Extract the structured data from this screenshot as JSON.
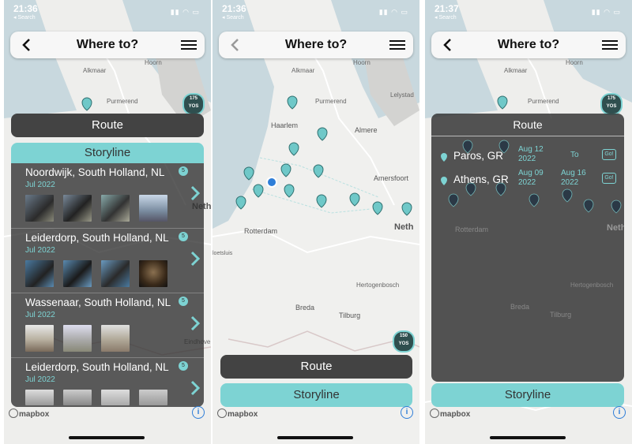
{
  "screens": [
    {
      "status": {
        "time": "21:36",
        "back": "◂ Search"
      },
      "header": {
        "title": "Where to?"
      },
      "route_label": "Route",
      "storyline_label": "Storyline",
      "cluster": {
        "count": "175",
        "label": "YOS"
      },
      "entries": [
        {
          "place": "Noordwijk, South Holland, NL",
          "date": "Jul 2022",
          "count": "5"
        },
        {
          "place": "Leiderdorp, South Holland, NL",
          "date": "Jul 2022",
          "count": "5"
        },
        {
          "place": "Wassenaar, South Holland, NL",
          "date": "Jul 2022",
          "count": "5"
        },
        {
          "place": "Leiderdorp, South Holland, NL",
          "date": "Jul 2022",
          "count": "5"
        }
      ],
      "mapbox": "mapbox",
      "info": "i"
    },
    {
      "status": {
        "time": "21:36",
        "back": "◂ Search"
      },
      "header": {
        "title": "Where to?"
      },
      "route_label": "Route",
      "storyline_label": "Storyline",
      "cluster": {
        "count": "150",
        "label": "YOS"
      },
      "mapbox": "mapbox",
      "info": "i"
    },
    {
      "status": {
        "time": "21:37",
        "back": "◂ Search"
      },
      "header": {
        "title": "Where to?"
      },
      "route_label": "Route",
      "storyline_label": "Storyline",
      "cluster": {
        "count": "175",
        "label": "YOS"
      },
      "destinations": [
        {
          "name": "Paros,  GR",
          "from": "Aug 12\n2022",
          "to_label": "To",
          "to": "",
          "go": "Go!"
        },
        {
          "name": "Athens,  GR",
          "from": "Aug 09\n2022",
          "to_label": "",
          "to": "Aug 16\n2022",
          "go": "Go!"
        }
      ],
      "mapbox": "mapbox",
      "info": "i"
    }
  ],
  "map_labels": {
    "hoorn": "Hoorn",
    "alkmaar": "Alkmaar",
    "purmerend": "Purmerend",
    "lelystad": "Lelystad",
    "haarlem": "Haarlem",
    "almere": "Almere",
    "amersfoort": "Amersfoort",
    "rotterdam": "Rotterdam",
    "hertogenbosch": "Hertogenbosch",
    "breda": "Breda",
    "tilburg": "Tilburg",
    "eindhoven": "Eindhove",
    "nether": "Neth",
    "gouda": "Gouda",
    "loetsluis": "loetsluis"
  },
  "colors": {
    "teal": "#7dd3d3",
    "dark_panel": "#434343",
    "pin": "#6fc8c8",
    "map_bg": "#eeeeec"
  }
}
